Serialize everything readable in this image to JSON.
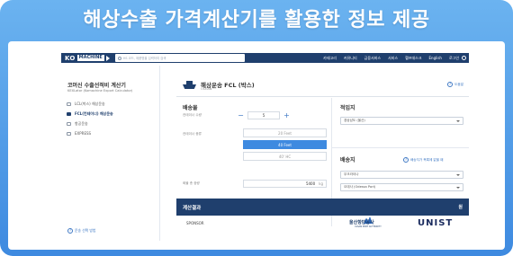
{
  "headline": "해상수출 가격계산기를 활용한 정보 제공",
  "nav": {
    "logo_ko": "KO",
    "logo_machine": "MACHINE",
    "search_placeholder": "HS 코드, 제품명을 입력하여 검색",
    "menu": [
      "카테고리",
      "커뮤니티",
      "금융서비스",
      "서비스",
      "헬프데스크",
      "English",
      "로그인"
    ]
  },
  "sidebar": {
    "title": "코머신 수출선적비 계산기",
    "subtitle": "KEXLator (Komachine Export Calculator)",
    "items": [
      {
        "label": "LCL(박스) 해상운송",
        "active": false
      },
      {
        "label": "FCL(컨테이너) 해상운송",
        "active": true
      },
      {
        "label": "항공운송",
        "active": false
      },
      {
        "label": "EXPRESS",
        "active": false
      }
    ],
    "help": "운송 선택 방법"
  },
  "main": {
    "title": "해상운송 FCL (박스)",
    "subtitle": "OCEAN",
    "help": "도움말",
    "cargo_heading": "배송물",
    "qty_label": "컨테이너 수량",
    "qty_value": "5",
    "type_label": "컨테이너 종류",
    "container_types": [
      {
        "label": "20 Feet",
        "selected": false
      },
      {
        "label": "40 Feet",
        "selected": true
      },
      {
        "label": "40' HC",
        "selected": false
      }
    ],
    "weight_label": "화물 총 중량",
    "weight_value": "5400",
    "weight_unit": "kg",
    "origin_heading": "적입지",
    "origin_select": "경상남도 (울산)",
    "dest_heading": "배송지",
    "dest_link": "배송지가 목록에 없을 때",
    "dest_country": "우크라이나",
    "dest_port": "오데사 (Odessa Port)",
    "reset_label": "선택해 계산하기"
  },
  "result": {
    "label": "계산결과",
    "currency": "원",
    "sponsor_label": "SPONSOR",
    "sponsor1_name": "울산항만공사",
    "sponsor1_en": "ULSAN PORT AUTHORITY",
    "sponsor2_name": "UNIST"
  }
}
